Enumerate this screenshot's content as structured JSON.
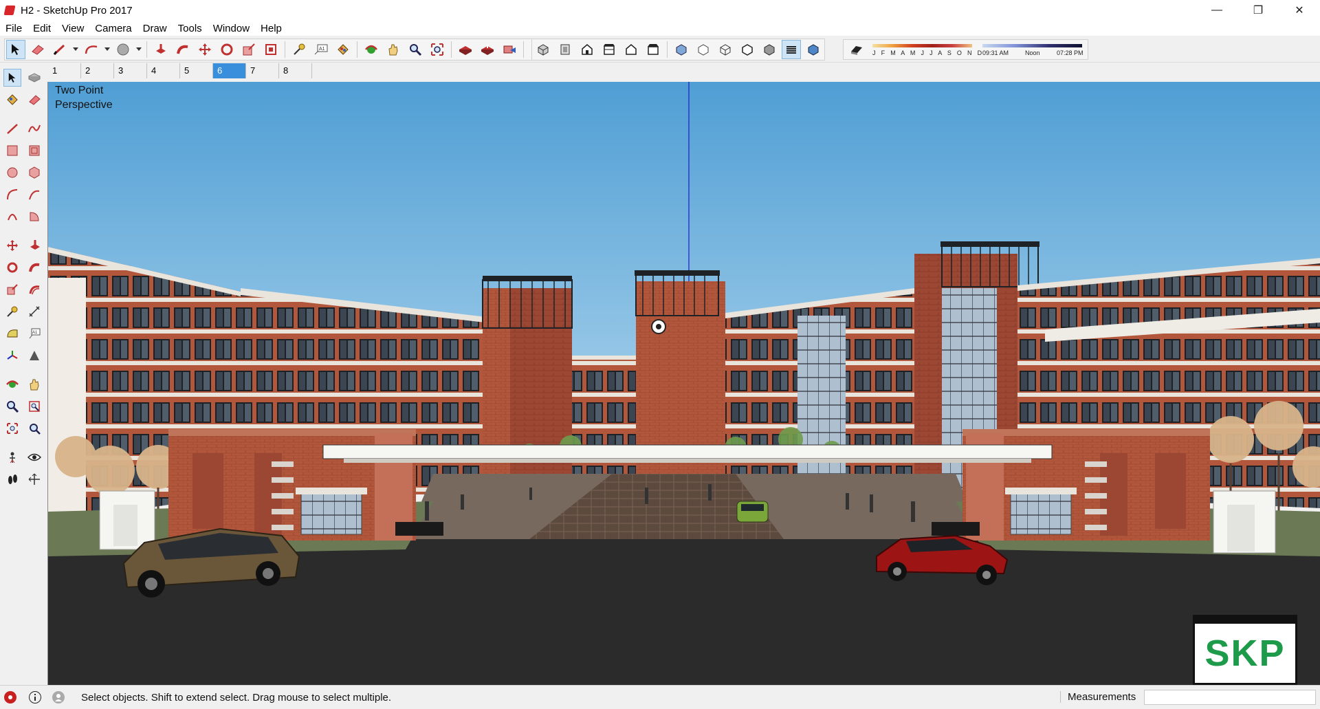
{
  "window": {
    "title": "H2 - SketchUp Pro 2017",
    "minimize": "—",
    "maximize": "❐",
    "close": "✕"
  },
  "menu": [
    "File",
    "Edit",
    "View",
    "Camera",
    "Draw",
    "Tools",
    "Window",
    "Help"
  ],
  "shadow_panel": {
    "months": "J F M A M J J A S O N D",
    "time_start": "09:31 AM",
    "time_mid": "Noon",
    "time_end": "07:28 PM"
  },
  "scenes": {
    "tabs": [
      "1",
      "2",
      "3",
      "4",
      "5",
      "6",
      "7",
      "8"
    ],
    "active_index": 5
  },
  "viewport": {
    "camera_line1": "Two Point",
    "camera_line2": "Perspective",
    "badge_text": "SKP",
    "sky_color": "#5fa9d8",
    "brick_color": "#b2573c",
    "road_color": "#2b2b2b"
  },
  "status": {
    "hint": "Select objects. Shift to extend select. Drag mouse to select multiple.",
    "measurements_label": "Measurements",
    "measurements_value": ""
  }
}
